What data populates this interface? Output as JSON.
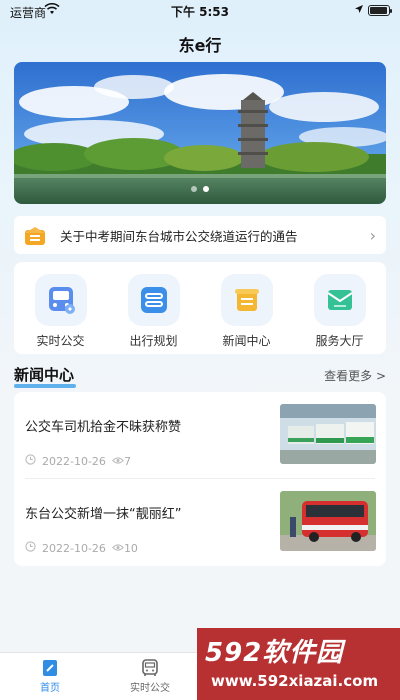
{
  "status_bar": {
    "carrier": "运营商",
    "time": "下午 5:53"
  },
  "app_title": "东e行",
  "notice": {
    "text": "关于中考期间东台城市公交绕道运行的通告"
  },
  "quick_actions": [
    {
      "label": "实时公交",
      "icon": "bus-icon"
    },
    {
      "label": "出行规划",
      "icon": "route-icon"
    },
    {
      "label": "新闻中心",
      "icon": "news-scroll-icon"
    },
    {
      "label": "服务大厅",
      "icon": "service-envelope-icon"
    }
  ],
  "news_section": {
    "title": "新闻中心",
    "more_label": "查看更多 >"
  },
  "news": [
    {
      "title": "公交车司机拾金不昧获称赞",
      "date": "2022-10-26",
      "views": "7"
    },
    {
      "title": "东台公交新增一抹“靓丽红”",
      "date": "2022-10-26",
      "views": "10"
    }
  ],
  "tabs": [
    {
      "label": "首页",
      "icon": "home-icon",
      "active": true
    },
    {
      "label": "实时公交",
      "icon": "bus-outline-icon",
      "active": false
    }
  ],
  "watermark": {
    "brand": "592软件园",
    "url": "www.592xiazai.com"
  },
  "colors": {
    "accent": "#2f8de4",
    "watermark_bg": "#b73032"
  }
}
